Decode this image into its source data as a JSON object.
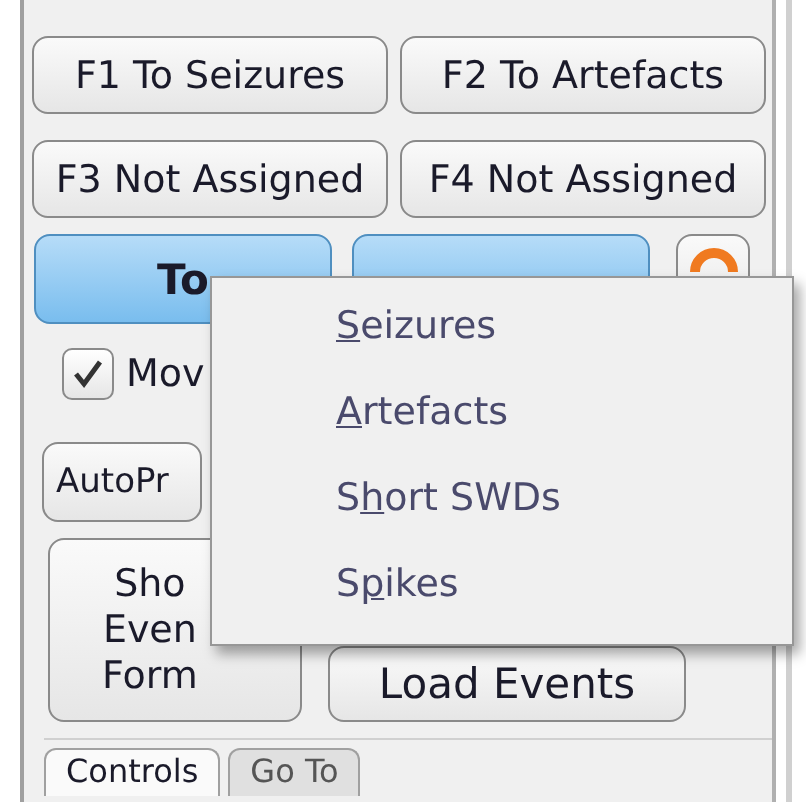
{
  "shortcut_buttons": [
    {
      "label": "F1 To Seizures"
    },
    {
      "label": "F2 To Artefacts"
    },
    {
      "label": "F3 Not Assigned"
    },
    {
      "label": "F4 Not Assigned"
    }
  ],
  "assign_buttons": [
    {
      "label": "To"
    }
  ],
  "move_checkbox": {
    "label": "Mov",
    "checked": true
  },
  "auto_button": {
    "label": "AutoPr"
  },
  "show_event_button": {
    "lines": [
      "Sho",
      "Even",
      "Form"
    ]
  },
  "load_events_button": {
    "label": "Load Events"
  },
  "tabs": [
    {
      "label": "Controls",
      "selected": true
    },
    {
      "label": "Go To",
      "selected": false
    }
  ],
  "menu": {
    "items": [
      {
        "mnemonic": "S",
        "rest": "eizures"
      },
      {
        "mnemonic": "A",
        "rest": "rtefacts"
      },
      {
        "lead": "S",
        "mnemonic": "h",
        "rest": "ort SWDs"
      },
      {
        "lead": "S",
        "mnemonic": "p",
        "rest": "ikes"
      }
    ]
  }
}
